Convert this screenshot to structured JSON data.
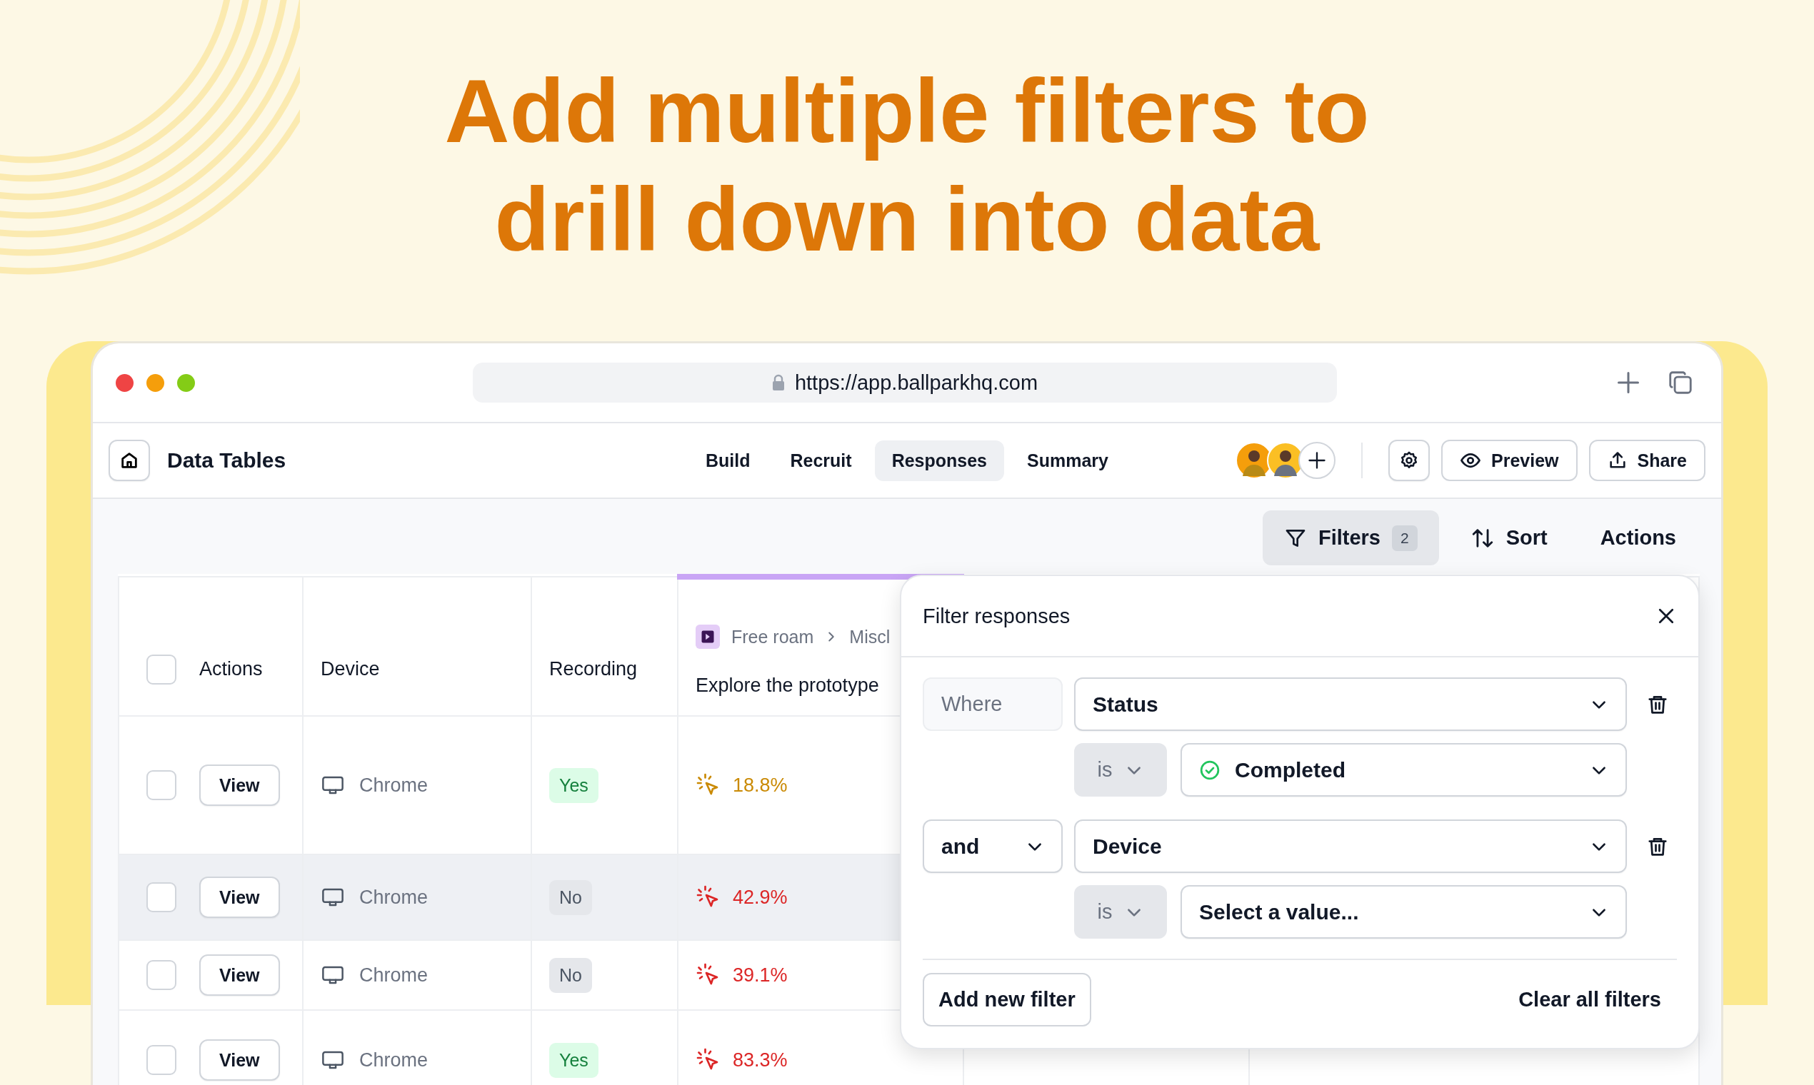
{
  "headline": [
    "Add multiple filters to",
    "drill down into data"
  ],
  "browser": {
    "url": "https://app.ballparkhq.com"
  },
  "app_header": {
    "title": "Data Tables",
    "tabs": [
      {
        "label": "Build",
        "selected": false
      },
      {
        "label": "Recruit",
        "selected": false
      },
      {
        "label": "Responses",
        "selected": true
      },
      {
        "label": "Summary",
        "selected": false
      }
    ],
    "preview": "Preview",
    "share": "Share"
  },
  "toolbar": {
    "filters": {
      "label": "Filters",
      "count": "2",
      "active": true
    },
    "sort": "Sort",
    "actions": "Actions"
  },
  "table": {
    "header_checked": false,
    "columns": [
      "Actions",
      "Device",
      "Recording",
      "Explore the prototype"
    ],
    "breadcrumb": [
      "Free roam",
      "Miscl"
    ],
    "rows": [
      {
        "checked": false,
        "highlighted": false,
        "action": "View",
        "device": "Chrome",
        "recording": "Yes",
        "recorded": true,
        "score": {
          "text": "18.8%",
          "color": "#ca8a04"
        }
      },
      {
        "checked": false,
        "highlighted": true,
        "action": "View",
        "device": "Chrome",
        "recording": "No",
        "recorded": false,
        "score": {
          "text": "42.9%",
          "color": "#dc2626"
        }
      },
      {
        "checked": false,
        "highlighted": false,
        "action": "View",
        "device": "Chrome",
        "recording": "No",
        "recorded": false,
        "score": {
          "text": "39.1%",
          "color": "#dc2626"
        }
      },
      {
        "checked": false,
        "highlighted": false,
        "action": "View",
        "device": "Chrome",
        "recording": "Yes",
        "recorded": true,
        "score": {
          "text": "83.3%",
          "color": "#dc2626"
        }
      }
    ]
  },
  "filter_panel": {
    "title": "Filter responses",
    "filters": [
      {
        "conjunction": {
          "kind": "label",
          "text": "Where"
        },
        "field": "Status",
        "operator": "is",
        "value": {
          "kind": "status",
          "text": "Completed"
        }
      },
      {
        "conjunction": {
          "kind": "dropdown",
          "text": "and"
        },
        "field": "Device",
        "operator": "is",
        "value": {
          "kind": "plain",
          "text": "Select a value..."
        }
      }
    ],
    "add_button": "Add new filter",
    "clear_button": "Clear all filters"
  }
}
